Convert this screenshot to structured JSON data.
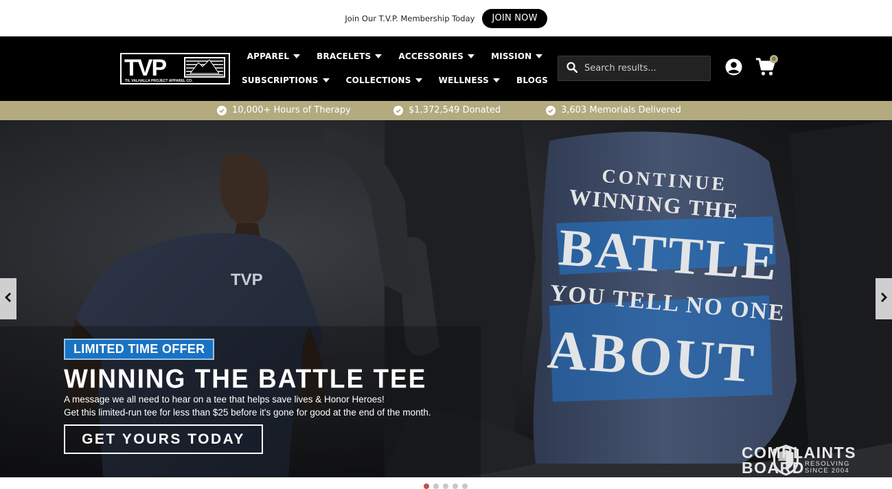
{
  "announcement": {
    "text": "Join Our T.V.P. Membership Today",
    "button_label": "JOIN NOW"
  },
  "header": {
    "logo_alt": "TVP - Til Valhalla Project Apparel Co.",
    "logo_letters": "TVP",
    "logo_caption": "TIL VALHALLA PROJECT APPAREL CO.",
    "nav_row1": [
      {
        "label": "APPAREL",
        "dropdown": true
      },
      {
        "label": "BRACELETS",
        "dropdown": true
      },
      {
        "label": "ACCESSORIES",
        "dropdown": true
      },
      {
        "label": "MISSION",
        "dropdown": true
      }
    ],
    "nav_row2": [
      {
        "label": "SUBSCRIPTIONS",
        "dropdown": true
      },
      {
        "label": "COLLECTIONS",
        "dropdown": true
      },
      {
        "label": "WELLNESS",
        "dropdown": true
      },
      {
        "label": "BLOGS",
        "dropdown": false
      }
    ],
    "search": {
      "placeholder": "Search results...",
      "value": ""
    },
    "account_icon": "user-circle-icon",
    "cart_icon": "shopping-cart-icon",
    "cart_count": "0"
  },
  "stats": [
    {
      "icon": "check-circle-icon",
      "label": "10,000+ Hours of Therapy"
    },
    {
      "icon": "check-circle-icon",
      "label": "$1,372,549 Donated"
    },
    {
      "icon": "check-circle-icon",
      "label": "3,603 Memorials Delivered"
    }
  ],
  "hero": {
    "badge": "LIMITED TIME OFFER",
    "title": "WINNING THE BATTLE TEE",
    "line1": "A message we all need to hear on a tee that helps save lives & Honor Heroes!",
    "line2": "Get this limited-run tee for less than $25 before it's gone for good at the end of the month.",
    "cta_label": "GET YOURS TODAY",
    "shirt_print": [
      "CONTINUE",
      "WINNING THE",
      "BATTLE",
      "YOU TELL NO ONE",
      "ABOUT"
    ],
    "chest_logo": "TVP",
    "prev_icon": "chevron-left-icon",
    "next_icon": "chevron-right-icon"
  },
  "watermark": {
    "line1": "COMPLAINTS",
    "line2": "BOARD",
    "sub1": "RESOLVING",
    "sub2": "SINCE 2004"
  },
  "slider": {
    "slide_count": 5,
    "active_index": 0
  },
  "colors": {
    "header_bg": "#000000",
    "stats_bg": "#b3aa80",
    "badge_blue": "#1a73c2",
    "active_dot": "#c0504d",
    "shirt_blue": "#3e4a63"
  }
}
